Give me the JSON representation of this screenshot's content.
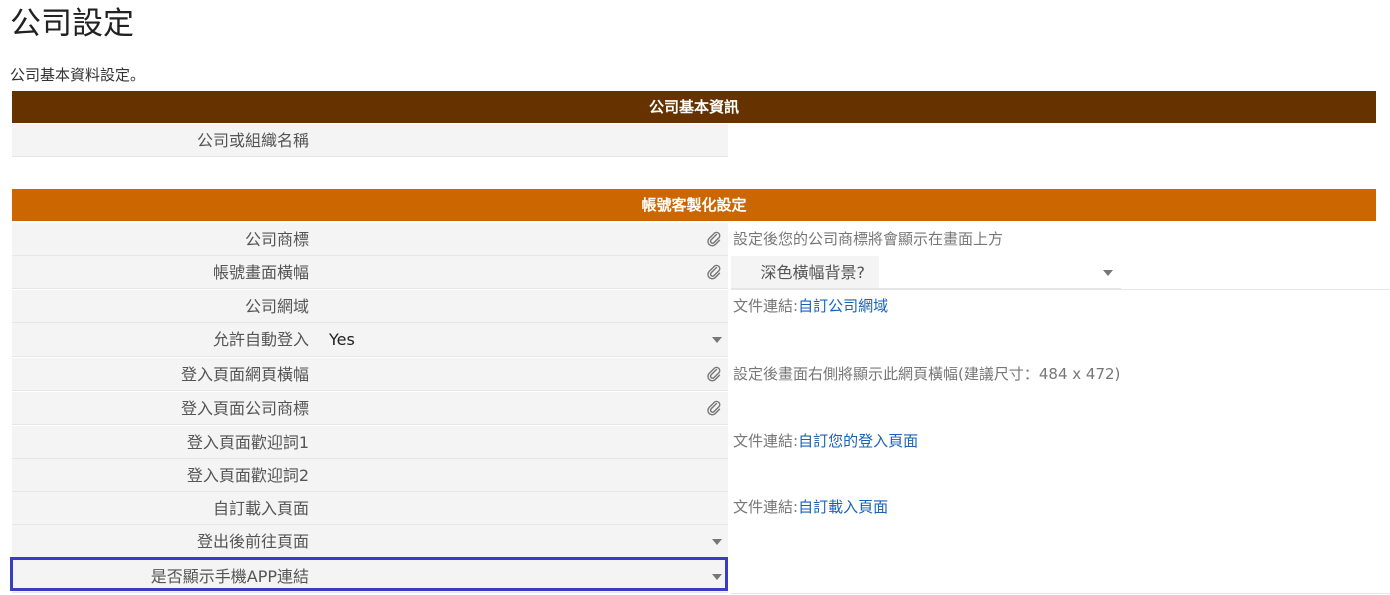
{
  "page": {
    "title": "公司設定",
    "description": "公司基本資料設定。"
  },
  "sections": {
    "basic": {
      "header": "公司基本資訊",
      "rows": [
        {
          "label": "公司或組織名稱",
          "value": ""
        }
      ]
    },
    "custom": {
      "header": "帳號客製化設定",
      "rows": [
        {
          "label": "公司商標",
          "value": "",
          "control": "file",
          "note": "設定後您的公司商標將會顯示在畫面上方"
        },
        {
          "label": "帳號畫面橫幅",
          "value": "",
          "control": "file",
          "extra_select_label": "深色橫幅背景?",
          "extra_select_value": ""
        },
        {
          "label": "公司網域",
          "value": "",
          "note_prefix": "文件連結:",
          "note_link": "自訂公司網域"
        },
        {
          "label": "允許自動登入",
          "value": "Yes",
          "control": "select"
        },
        {
          "label": "登入頁面網頁橫幅",
          "value": "",
          "control": "file",
          "note": "設定後畫面右側將顯示此網頁橫幅(建議尺寸：484 x 472)"
        },
        {
          "label": "登入頁面公司商標",
          "value": "",
          "control": "file"
        },
        {
          "label": "登入頁面歡迎詞1",
          "value": "",
          "note_prefix": "文件連結:",
          "note_link": "自訂您的登入頁面"
        },
        {
          "label": "登入頁面歡迎詞2",
          "value": ""
        },
        {
          "label": "自訂載入頁面",
          "value": "",
          "note_prefix": "文件連結:",
          "note_link": "自訂載入頁面"
        },
        {
          "label": "登出後前往頁面",
          "value": "",
          "control": "select"
        },
        {
          "label": "是否顯示手機APP連結",
          "value": "",
          "control": "select"
        }
      ]
    }
  },
  "icons": {
    "file": "paperclip-icon",
    "select": "chevron-down-icon"
  },
  "colors": {
    "basic_header": "#663300",
    "custom_header": "#cc6600",
    "link": "#1a62b8",
    "highlight": "#3a3dc0"
  }
}
